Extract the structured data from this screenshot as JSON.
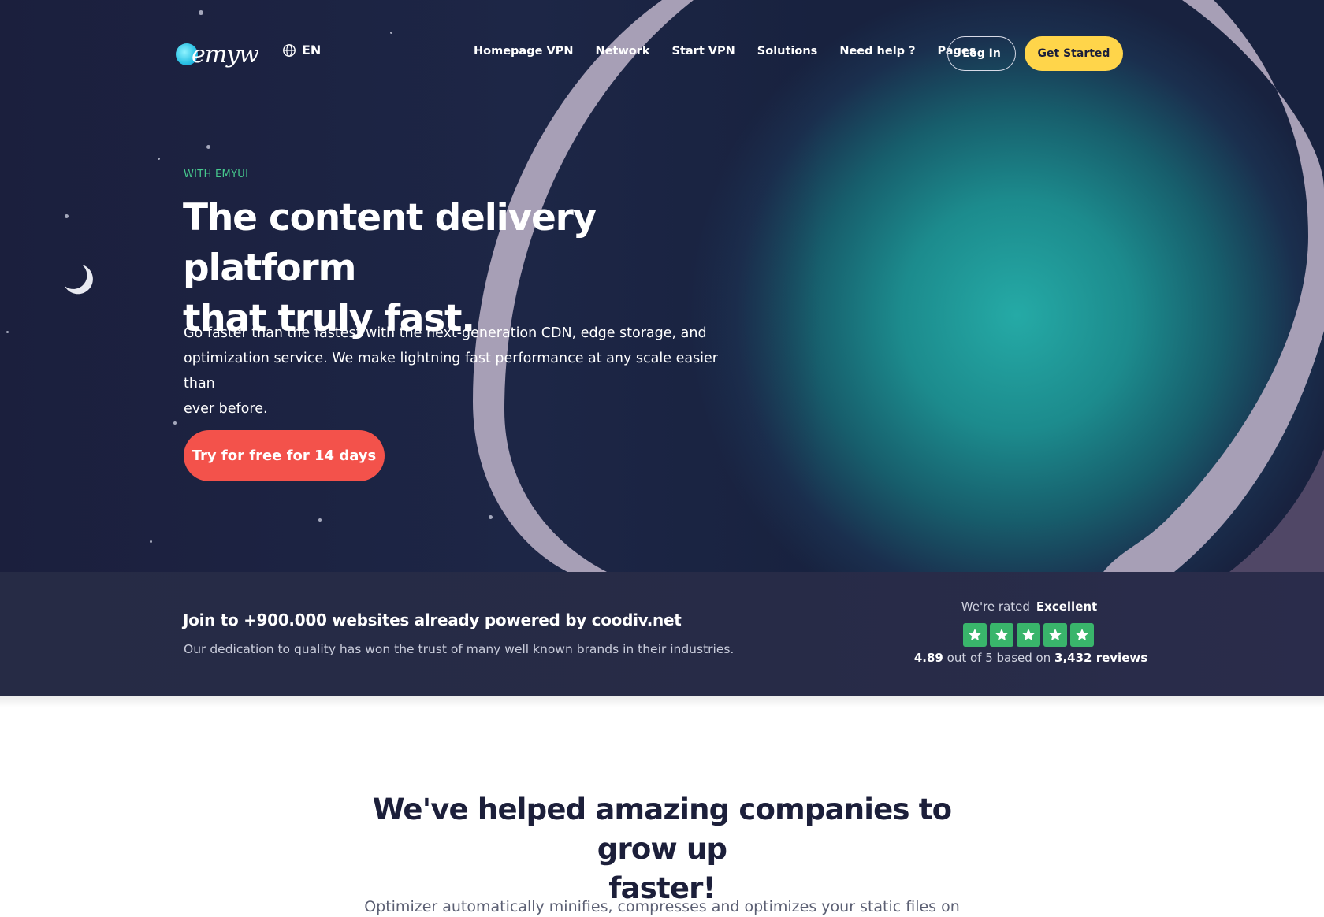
{
  "brand": {
    "logo_text": "emyw",
    "accent": "#ffd54a",
    "cta_color": "#f3524b",
    "eyebrow_color": "#47c98d"
  },
  "language": {
    "icon": "globe-icon",
    "code": "EN"
  },
  "nav": {
    "items": [
      {
        "label": "Homepage VPN"
      },
      {
        "label": "Network"
      },
      {
        "label": "Start VPN"
      },
      {
        "label": "Solutions"
      },
      {
        "label": "Need help ?"
      },
      {
        "label": "Pages"
      }
    ],
    "login_label": "Log In",
    "get_started_label": "Get Started"
  },
  "hero": {
    "eyebrow": "WITH EMYUI",
    "headline_line1": "The content delivery platform",
    "headline_line2": "that truly fast.",
    "lead_line1": "Go faster than the fastest with the next-generation CDN, edge storage, and",
    "lead_line2": "optimization service. We make lightning fast performance at any scale easier than",
    "lead_line3": "ever before.",
    "cta_label": "Try for free for 14 days"
  },
  "trust": {
    "title": "Join to +900.000 websites already powered by coodiv.net",
    "subtitle": "Our dedication to quality has won the trust of many well known brands in their industries.",
    "rated_prefix": "We're rated",
    "rated_word": "Excellent",
    "star_count": 5,
    "star_color": "#39b56b",
    "score": "4.89",
    "score_middle": "out of 5 based on",
    "reviews": "3,432 reviews"
  },
  "section": {
    "title_line1": "We've helped amazing companies to grow up",
    "title_line2": "faster!",
    "text": "Optimizer automatically minifies, compresses and optimizes your static files on"
  }
}
